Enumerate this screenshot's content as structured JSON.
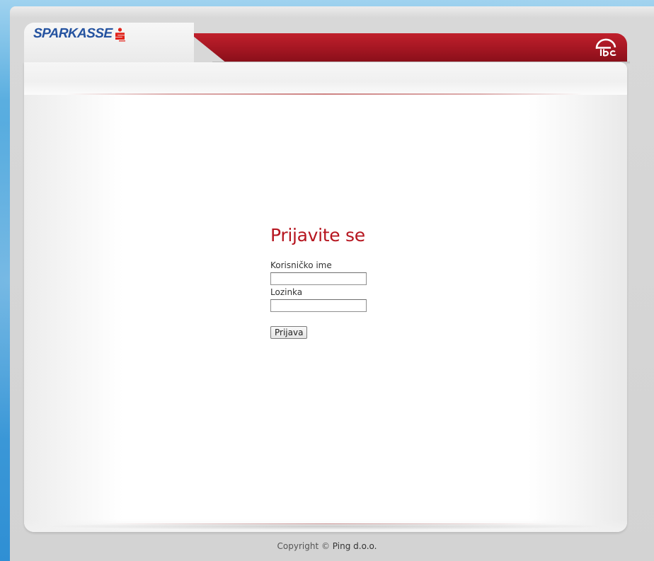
{
  "header": {
    "logo_text": "SPARKASSE",
    "brand_icon": "ebc-logo-icon",
    "logo_icon": "sparkasse-s-icon"
  },
  "colors": {
    "accent_red": "#b6151f",
    "logo_blue": "#2553a0",
    "band_red": "#a41622"
  },
  "login": {
    "title": "Prijavite se",
    "username_label": "Korisničko ime",
    "username_value": "",
    "password_label": "Lozinka",
    "password_value": "",
    "submit_label": "Prijava"
  },
  "footer": {
    "copyright_prefix": "Copyright ©",
    "owner": "Ping d.o.o."
  }
}
